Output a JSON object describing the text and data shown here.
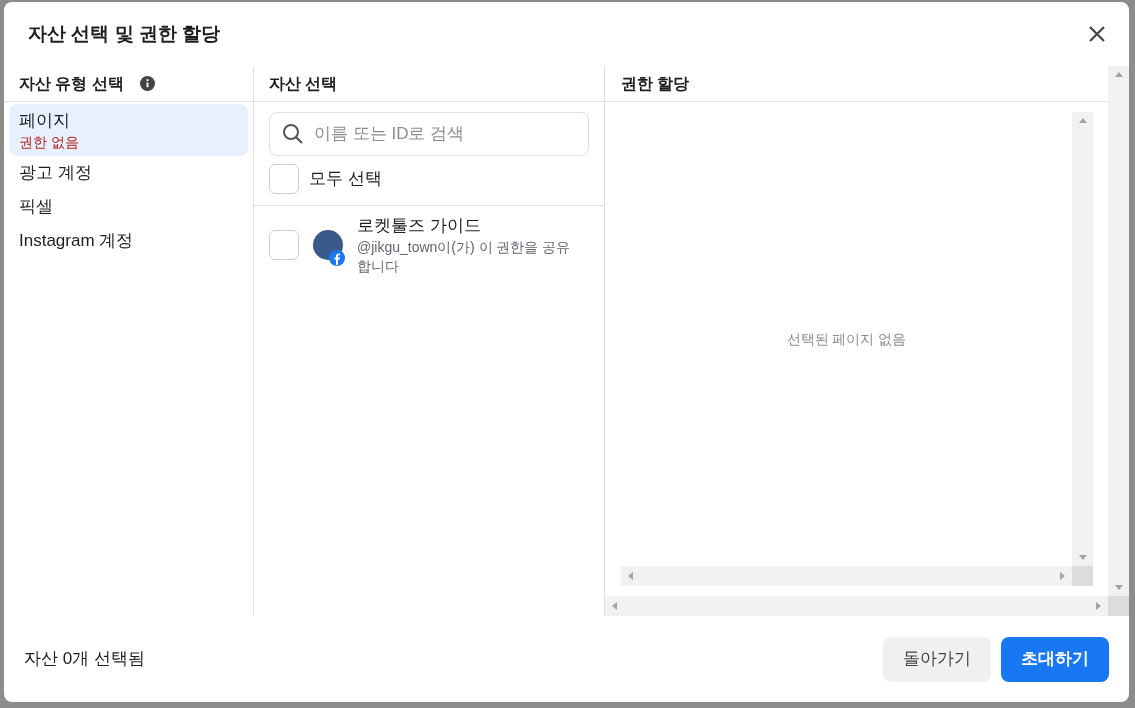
{
  "dialog": {
    "title": "자산 선택 및 권한 할당"
  },
  "asset_types": {
    "heading": "자산 유형 선택",
    "items": [
      {
        "label": "페이지",
        "status": "권한 없음",
        "selected": true
      },
      {
        "label": "광고 계정",
        "selected": false
      },
      {
        "label": "픽셀",
        "selected": false
      },
      {
        "label": "Instagram 계정",
        "selected": false
      }
    ]
  },
  "assets": {
    "heading": "자산 선택",
    "search": {
      "placeholder": "이름 또는 ID로 검색"
    },
    "select_all": {
      "label": "모두 선택",
      "checked": false
    },
    "items": [
      {
        "name": "로켓툴즈 가이드",
        "note": "@jikgu_town이(가) 이 권한을 공유합니다",
        "checked": false
      }
    ]
  },
  "permissions": {
    "heading": "권한 할당",
    "empty_message": "선택된 페이지 없음"
  },
  "footer": {
    "summary": "자산 0개 선택됨",
    "buttons": [
      {
        "label": "돌아가기",
        "kind": "secondary"
      },
      {
        "label": "초대하기",
        "kind": "primary"
      }
    ]
  }
}
